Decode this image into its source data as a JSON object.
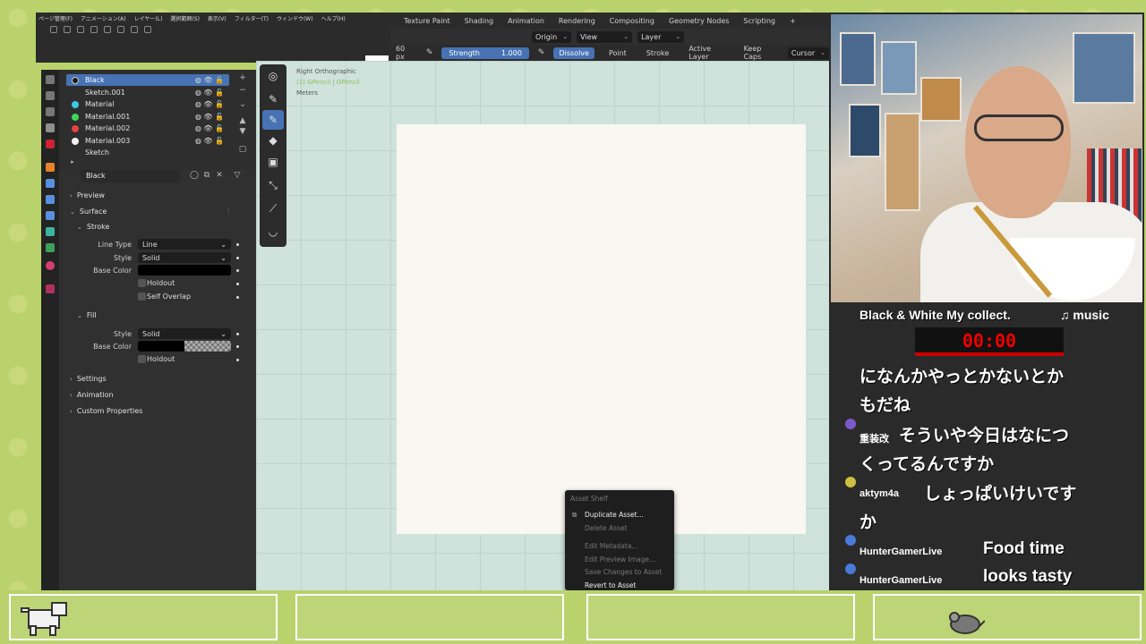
{
  "menu": [
    "ページ管理(F)",
    "アニメーション(A)",
    "レイヤー(L)",
    "選択範囲(S)",
    "表示(V)",
    "フィルター(T)",
    "ウィンドウ(W)",
    "ヘルプ(H)"
  ],
  "workspaces": [
    "Texture Paint",
    "Shading",
    "Animation",
    "Rendering",
    "Compositing",
    "Geometry Nodes",
    "Scripting",
    "+"
  ],
  "header2": {
    "origin": "Origin",
    "view": "View",
    "layer": "Layer"
  },
  "header3": {
    "size": "60 px",
    "strength_label": "Strength",
    "strength_value": "1.000",
    "dissolve": "Dissolve",
    "point": "Point",
    "stroke": "Stroke",
    "active_layer": "Active Layer",
    "keep_caps": "Keep Caps",
    "cursor": "Cursor"
  },
  "materials": [
    {
      "name": "Black",
      "color": "#1a1a1a",
      "selected": true
    },
    {
      "name": "Sketch.001",
      "color": ""
    },
    {
      "name": "Material",
      "color": "#3ec7e6"
    },
    {
      "name": "Material.001",
      "color": "#3ed65a"
    },
    {
      "name": "Material.002",
      "color": "#e64040"
    },
    {
      "name": "Material.003",
      "color": "#f2f2f2"
    },
    {
      "name": "Sketch",
      "color": ""
    }
  ],
  "material_name": "Black",
  "properties": {
    "preview": "Preview",
    "surface": "Surface",
    "stroke": "Stroke",
    "line_type_label": "Line Type",
    "line_type_value": "Line",
    "style_label": "Style",
    "style_value": "Solid",
    "base_color_label": "Base Color",
    "holdout": "Holdout",
    "self_overlap": "Self Overlap",
    "fill": "Fill",
    "fill_style_label": "Style",
    "fill_style_value": "Solid",
    "fill_base_color_label": "Base Color",
    "fill_holdout": "Holdout",
    "settings": "Settings",
    "animation": "Animation",
    "custom_properties": "Custom Properties"
  },
  "viewport": {
    "view_name": "Right Orthographic",
    "object": "(1) GPencil | GPencil",
    "units": "Meters"
  },
  "asset_menu": {
    "title": "Asset Shelf",
    "items": [
      {
        "label": "Duplicate Asset...",
        "enabled": true
      },
      {
        "label": "Delete Asset",
        "enabled": false
      },
      {
        "label": "Edit Metadata...",
        "enabled": false
      },
      {
        "label": "Edit Preview Image...",
        "enabled": false
      },
      {
        "label": "Save Changes to Asset",
        "enabled": false
      },
      {
        "label": "Revert to Asset",
        "enabled": true
      }
    ]
  },
  "stream": {
    "title": "Black & White My collect.",
    "music": "♫ music",
    "timer": "00:00",
    "messages": [
      {
        "user": "",
        "text": "になんかやっとかないとか"
      },
      {
        "user": "",
        "text": "もだね"
      },
      {
        "user": "重装改",
        "text": "そういや今日はなにつ"
      },
      {
        "user": "",
        "text": "くってるんですか"
      },
      {
        "user": "aktym4a",
        "text": "しょっぱいけいです"
      },
      {
        "user": "",
        "text": "か"
      },
      {
        "user": "HunterGamerLive",
        "text": "Food time"
      },
      {
        "user": "HunterGamerLive",
        "text": "looks tasty"
      }
    ]
  },
  "colors": {
    "accent": "#4772b3",
    "timer_red": "#e00000",
    "bg_green": "#b9d26c"
  }
}
